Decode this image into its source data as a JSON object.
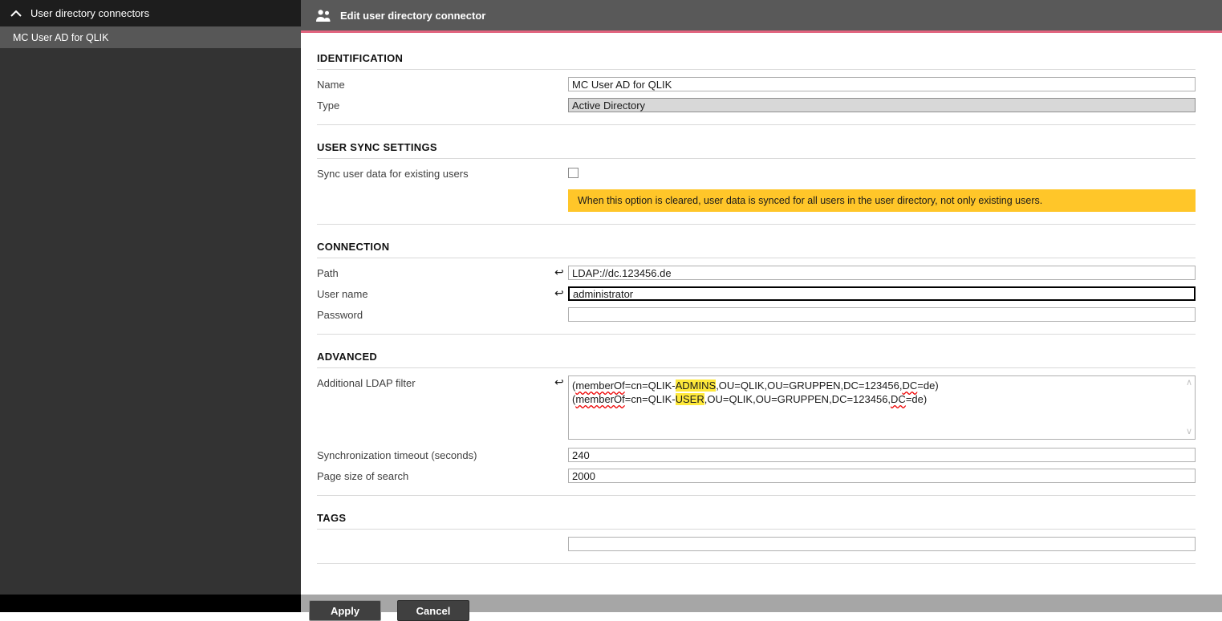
{
  "sidebar": {
    "header": "User directory connectors",
    "items": [
      {
        "label": "MC User AD for QLIK",
        "selected": true
      }
    ]
  },
  "header": {
    "title": "Edit user directory connector"
  },
  "sections": {
    "identification": {
      "title": "IDENTIFICATION",
      "name_label": "Name",
      "name_value": "MC User AD for QLIK",
      "type_label": "Type",
      "type_value": "Active Directory"
    },
    "user_sync": {
      "title": "USER SYNC SETTINGS",
      "sync_label": "Sync user data for existing users",
      "sync_checked": false,
      "warning": "When this option is cleared, user data is synced for all users in the user directory, not only existing users."
    },
    "connection": {
      "title": "CONNECTION",
      "path_label": "Path",
      "path_value": "LDAP://dc.123456.de",
      "username_label": "User name",
      "username_value": "administrator",
      "password_label": "Password",
      "password_value": ""
    },
    "advanced": {
      "title": "ADVANCED",
      "filter_label": "Additional LDAP filter",
      "filter_lines": [
        [
          {
            "t": "("
          },
          {
            "t": "memberOf",
            "sp": true
          },
          {
            "t": "=cn=QLIK-"
          },
          {
            "t": "ADMINS",
            "hl": true
          },
          {
            "t": ",OU=QLIK,OU=GRUPPEN,DC=123456,"
          },
          {
            "t": "DC",
            "sp": true
          },
          {
            "t": "=de)"
          }
        ],
        [
          {
            "t": "("
          },
          {
            "t": "memberOf",
            "sp": true
          },
          {
            "t": "=cn=QLIK-"
          },
          {
            "t": "USER",
            "hl": true
          },
          {
            "t": ",OU=QLIK,OU=GRUPPEN,DC=123456,"
          },
          {
            "t": "DC",
            "sp": true
          },
          {
            "t": "=de)"
          }
        ]
      ],
      "timeout_label": "Synchronization timeout (seconds)",
      "timeout_value": "240",
      "pagesize_label": "Page size of search",
      "pagesize_value": "2000"
    },
    "tags": {
      "title": "TAGS",
      "value": ""
    }
  },
  "footer": {
    "apply_label": "Apply",
    "cancel_label": "Cancel"
  },
  "icons": {
    "undo": "↩",
    "scroll_up": "∧",
    "scroll_down": "∨"
  },
  "colors": {
    "accent_line": "#e2647f",
    "warning_bg": "#ffc629",
    "highlight": "#ffe93b",
    "sidebar_bg": "#333333",
    "header_bg": "#595959",
    "selected_item_bg": "#575757",
    "footer_bg": "#a6a6a6",
    "button_bg": "#404040"
  }
}
